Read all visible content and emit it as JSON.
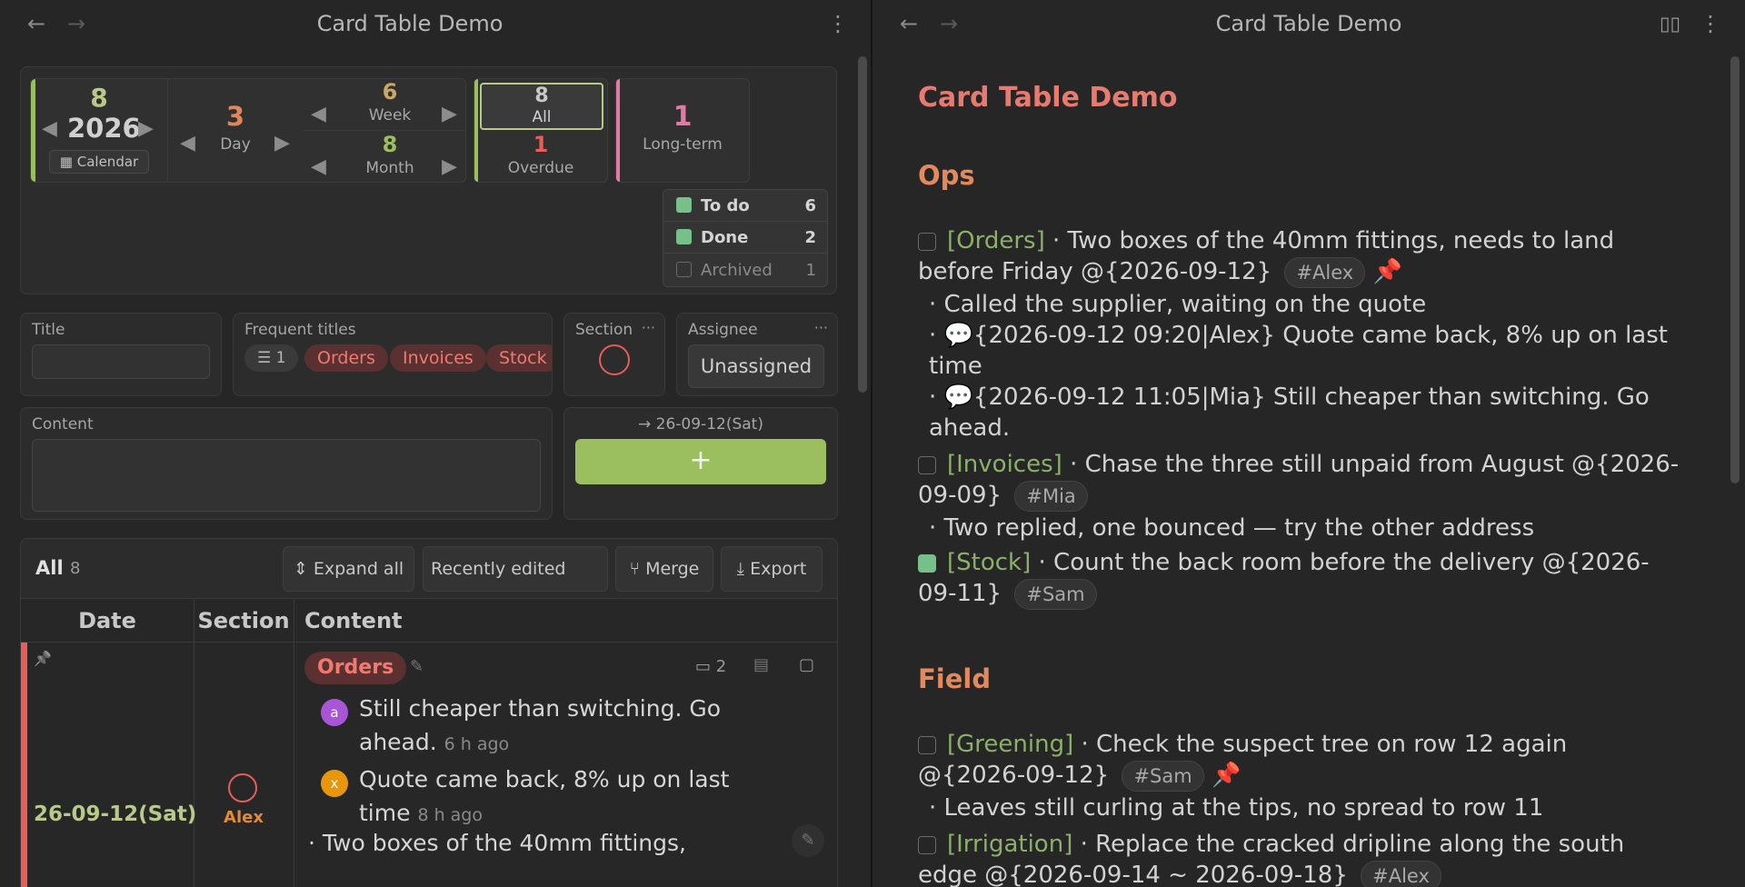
{
  "left": {
    "title": "Card Table Demo",
    "nav_back": "←",
    "nav_fwd": "→",
    "kebab": "⋮",
    "calendar": {
      "top_value": "8",
      "year": "2026",
      "prev": "◀",
      "next": "▶",
      "button": "Calendar",
      "cal_icon": "▦"
    },
    "day": {
      "value": "3",
      "label": "Day"
    },
    "week": {
      "value": "6",
      "label": "Week"
    },
    "month": {
      "value": "8",
      "label": "Month"
    },
    "all": {
      "value": "8",
      "label": "All"
    },
    "overdue": {
      "value": "1",
      "label": "Overdue"
    },
    "longterm": {
      "value": "1",
      "label": "Long-term"
    },
    "status": [
      {
        "label": "To do",
        "count": "6",
        "checked": true
      },
      {
        "label": "Done",
        "count": "2",
        "checked": true
      },
      {
        "label": "Archived",
        "count": "1",
        "checked": false
      }
    ],
    "form": {
      "title_label": "Title",
      "frequent_label": "Frequent titles",
      "frequent_count": "1",
      "frequent_chips": [
        "Orders",
        "Invoices",
        "Stock"
      ],
      "section_label": "Section",
      "assignee_label": "Assignee",
      "assignee_value": "Unassigned",
      "content_label": "Content",
      "target_date": "→ 26-09-12(Sat)",
      "add_label": "+",
      "dots": "···"
    },
    "toolbar": {
      "scope": "All",
      "count": "8",
      "expand": "Expand all",
      "sort": "Recently edited",
      "merge": "Merge",
      "export": "Export"
    },
    "table": {
      "headers": [
        "Date",
        "Section",
        "Content"
      ],
      "row": {
        "pin": "📌",
        "date": "26-09-12(Sat)",
        "assignee": "Alex",
        "section_chip": "Orders",
        "comment_count": "2",
        "comments": [
          {
            "avatar": "a",
            "color": "#a855d8",
            "text": "Still cheaper than switching. Go ahead.",
            "ago": "6 h ago"
          },
          {
            "avatar": "x",
            "color": "#e8960c",
            "text": "Quote came back, 8% up on last time",
            "ago": "8 h ago"
          }
        ],
        "content_preview": "· Two boxes of the 40mm fittings,"
      }
    }
  },
  "right": {
    "title": "Card Table Demo",
    "doc_title": "Card Table Demo",
    "sections": [
      {
        "heading": "Ops",
        "items": [
          {
            "checked": false,
            "section": "[Orders]",
            "text": "· Two boxes of the 40mm fittings, needs to land before Friday @{2026-09-12}",
            "tag": "#Alex",
            "pinned": true,
            "subs": [
              "· Called the supplier, waiting on the quote",
              "· 💬{2026-09-12 09:20|Alex} Quote came back, 8% up on last time",
              "· 💬{2026-09-12 11:05|Mia} Still cheaper than switching. Go ahead."
            ]
          },
          {
            "checked": false,
            "section": "[Invoices]",
            "text": "· Chase the three still unpaid from August @{2026-09-09}",
            "tag": "#Mia",
            "pinned": false,
            "subs": [
              "· Two replied, one bounced — try the other address"
            ]
          },
          {
            "checked": true,
            "section": "[Stock]",
            "text": "· Count the back room before the delivery @{2026-09-11}",
            "tag": "#Sam",
            "pinned": false,
            "subs": []
          }
        ]
      },
      {
        "heading": "Field",
        "items": [
          {
            "checked": false,
            "section": "[Greening]",
            "text": "· Check the suspect tree on row 12 again @{2026-09-12}",
            "tag": "#Sam",
            "pinned": true,
            "subs": [
              "· Leaves still curling at the tips, no spread to row 11"
            ]
          },
          {
            "checked": false,
            "section": "[Irrigation]",
            "text": "· Replace the cracked dripline along the south edge @{2026-09-14 ~ 2026-09-18}",
            "tag": "#Alex",
            "pinned": false,
            "subs": []
          }
        ]
      }
    ]
  },
  "colors": {
    "accent_green": "#9bbf5e",
    "accent_red": "#e85d58",
    "orange": "#e08a3c",
    "bg": "#262626"
  }
}
